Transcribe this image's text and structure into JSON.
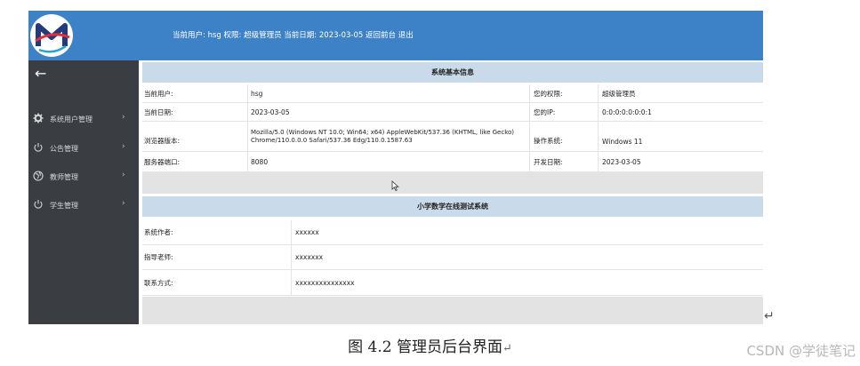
{
  "header": {
    "logo_letter": "M",
    "user_label": "当前用户:",
    "user_name": "hsg",
    "role_label": "权限:",
    "role_value": "超级管理员",
    "date_label": "当前日期:",
    "date_value": "2023-03-05",
    "back_link": "返回前台",
    "logout_link": "退出"
  },
  "sidebar": {
    "back_icon": "arrow-left-icon",
    "items": [
      {
        "label": "系统用户管理",
        "icon": "gear-icon"
      },
      {
        "label": "公告管理",
        "icon": "power-icon"
      },
      {
        "label": "教师管理",
        "icon": "globe-icon"
      },
      {
        "label": "学生管理",
        "icon": "power-icon"
      }
    ]
  },
  "system_info": {
    "title": "系统基本信息",
    "rows": [
      {
        "label1": "当前用户:",
        "value1": "hsg",
        "label2": "您的权限:",
        "value2": "超级管理员"
      },
      {
        "label1": "当前日期:",
        "value1": "2023-03-05",
        "label2": "您的IP:",
        "value2": "0:0:0:0:0:0:0:1"
      },
      {
        "label1": "浏览器版本:",
        "value1": "Mozilla/5.0 (Windows NT 10.0; Win64; x64) AppleWebKit/537.36 (KHTML, like Gecko) Chrome/110.0.0.0 Safari/537.36 Edg/110.0.1587.63",
        "label2": "操作系统:",
        "value2": "Windows 11"
      },
      {
        "label1": "服务器端口:",
        "value1": "8080",
        "label2": "开发日期:",
        "value2": "2023-03-05"
      }
    ]
  },
  "project_info": {
    "title": "小学数学在线测试系统",
    "rows": [
      {
        "label": "系统作者:",
        "value": "xxxxxx"
      },
      {
        "label": "指导老师:",
        "value": "xxxxxxx"
      },
      {
        "label": "联系方式:",
        "value": "xxxxxxxxxxxxxxx"
      }
    ]
  },
  "caption": {
    "text": "图 4.2 管理员后台界面",
    "return_mark": "↵"
  },
  "watermark": "CSDN @学徒笔记",
  "colors": {
    "header_bg": "#3d82c6",
    "sidebar_bg": "#3a3d42",
    "section_head_bg": "#c9daea",
    "gray_band": "#e3e3e3"
  }
}
